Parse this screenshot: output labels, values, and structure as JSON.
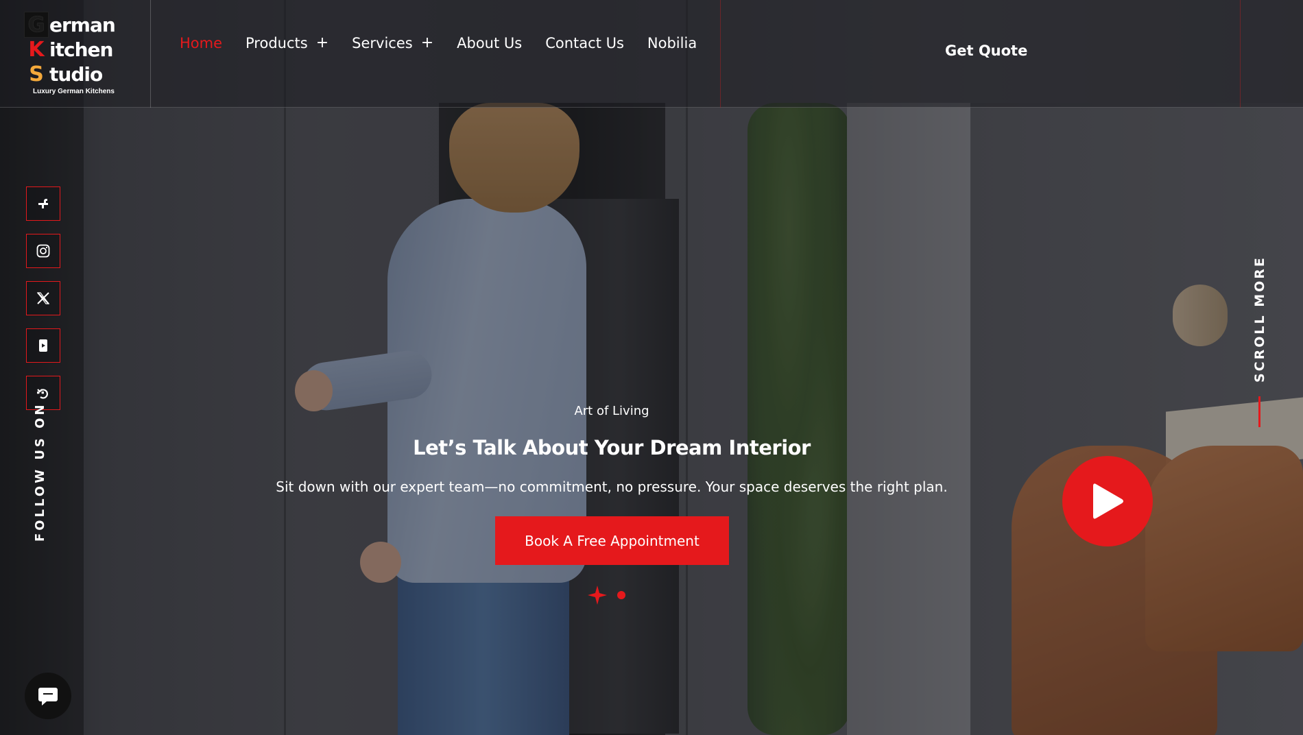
{
  "brand": {
    "letters": [
      "G",
      "K",
      "S"
    ],
    "words": [
      "erman",
      "itchen",
      "tudio"
    ],
    "tagline": "Luxury German Kitchens",
    "letter_colors": [
      "#111111",
      "#e5191c",
      "#f4a93b"
    ]
  },
  "nav": {
    "items": [
      {
        "label": "Home",
        "active": true,
        "has_plus": false
      },
      {
        "label": "Products",
        "active": false,
        "has_plus": true
      },
      {
        "label": "Services",
        "active": false,
        "has_plus": true
      },
      {
        "label": "About Us",
        "active": false,
        "has_plus": false
      },
      {
        "label": "Contact Us",
        "active": false,
        "has_plus": false
      },
      {
        "label": "Nobilia",
        "active": false,
        "has_plus": false
      }
    ],
    "plus_symbol": "+",
    "cta_label": "Get Quote"
  },
  "social": {
    "follow_label": "FOLLOW US ON :",
    "icons": [
      "facebook-icon",
      "instagram-icon",
      "x-twitter-icon",
      "youtube-icon",
      "threads-icon"
    ]
  },
  "scroll": {
    "label": "SCROLL MORE"
  },
  "hero": {
    "kicker": "Art of Living",
    "title": "Let’s Talk About Your Dream Interior",
    "subtitle": "Sit down with our expert team—no commitment, no pressure. Your space deserves the right plan.",
    "button_label": "Book A Free Appointment"
  },
  "colors": {
    "accent": "#e5191c",
    "text": "#ffffff",
    "header_bg": "#1e1e22"
  }
}
